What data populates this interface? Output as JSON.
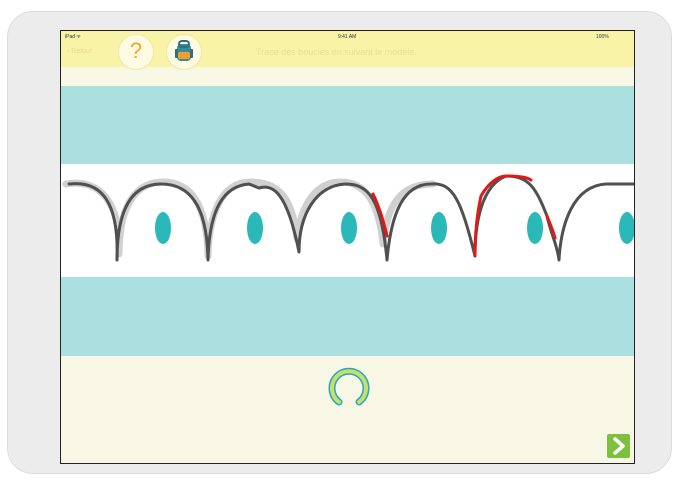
{
  "status_bar": {
    "carrier": "iPad ᯤ",
    "time": "9:41 AM",
    "battery": "100%"
  },
  "nav": {
    "back_label": "‹ Retour",
    "title": "Trace des boucles en suivant le modèle."
  },
  "icons": {
    "help": "question-mark-icon",
    "backpack": "backpack-icon",
    "loader": "progress-ring-icon",
    "next": "chevron-right-icon"
  },
  "colors": {
    "band": "#abdfe0",
    "status_bar": "#f9f3a8",
    "dot": "#2bb8b8",
    "stroke": "#505050",
    "error_stroke": "#e01818",
    "next_button": "#7cc03c"
  }
}
